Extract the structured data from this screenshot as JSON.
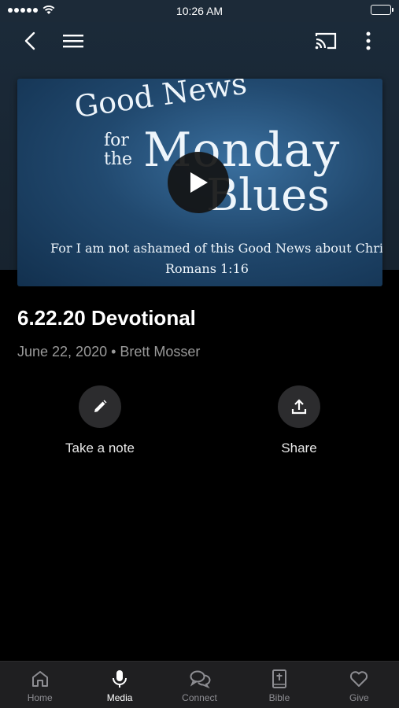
{
  "status": {
    "time": "10:26 AM"
  },
  "artwork": {
    "line1": "Good News",
    "line2a": "for",
    "line2b": "the",
    "line3": "Monday",
    "line4": "Blues",
    "verse": "For I am not ashamed of this Good News about Christ.",
    "reference": "Romans 1:16"
  },
  "item": {
    "title": "6.22.20 Devotional",
    "meta": "June 22, 2020 • Brett Mosser"
  },
  "actions": {
    "note_label": "Take a note",
    "share_label": "Share"
  },
  "tabs": [
    {
      "label": "Home",
      "icon": "home-icon"
    },
    {
      "label": "Media",
      "icon": "microphone-icon"
    },
    {
      "label": "Connect",
      "icon": "chat-bubbles-icon"
    },
    {
      "label": "Bible",
      "icon": "bible-icon"
    },
    {
      "label": "Give",
      "icon": "heart-icon"
    }
  ],
  "active_tab": "Media"
}
